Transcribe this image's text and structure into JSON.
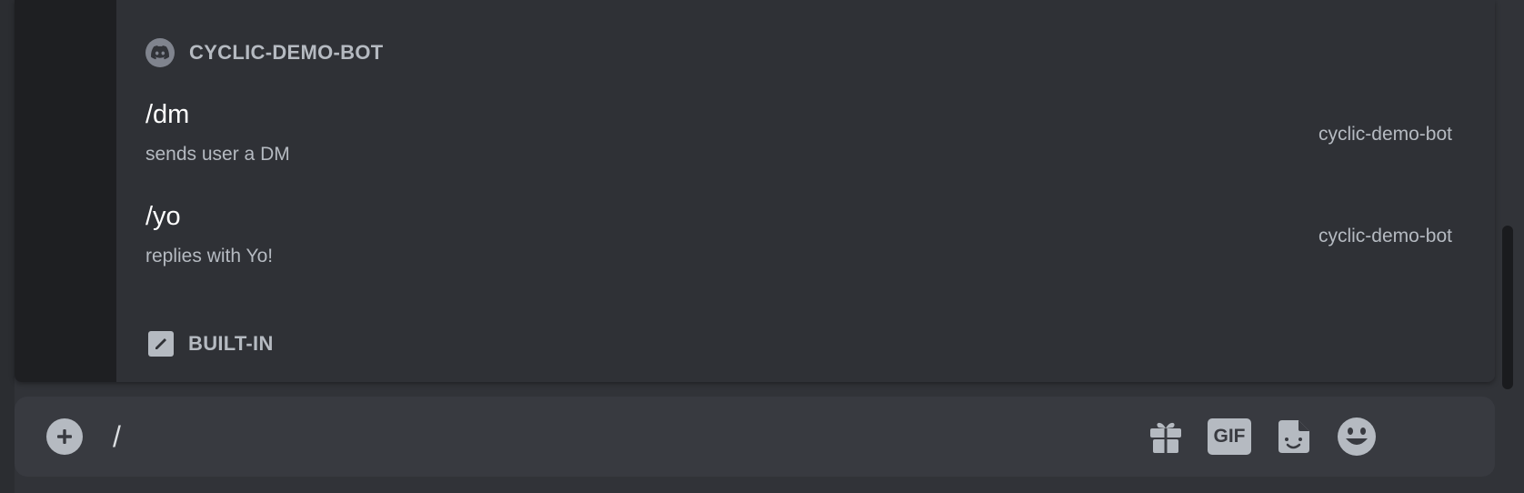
{
  "autocomplete": {
    "sections": [
      {
        "title": "CYCLIC-DEMO-BOT",
        "icon": "discord-bot-icon",
        "commands": [
          {
            "name": "/dm",
            "description": "sends user a DM",
            "source": "cyclic-demo-bot"
          },
          {
            "name": "/yo",
            "description": "replies with Yo!",
            "source": "cyclic-demo-bot"
          }
        ]
      },
      {
        "title": "BUILT-IN",
        "icon": "slash-command-icon",
        "commands": []
      }
    ]
  },
  "composer": {
    "value": "/",
    "icons": [
      "add-attachment-icon",
      "gift-icon",
      "gif-icon",
      "sticker-icon",
      "emoji-icon"
    ],
    "gif_label": "GIF"
  },
  "colors": {
    "background": "#313338",
    "popout": "#2f3136",
    "rail": "#1e1f22",
    "composer": "#383a40",
    "text_primary": "#ffffff",
    "text_muted": "#b5bac1"
  }
}
